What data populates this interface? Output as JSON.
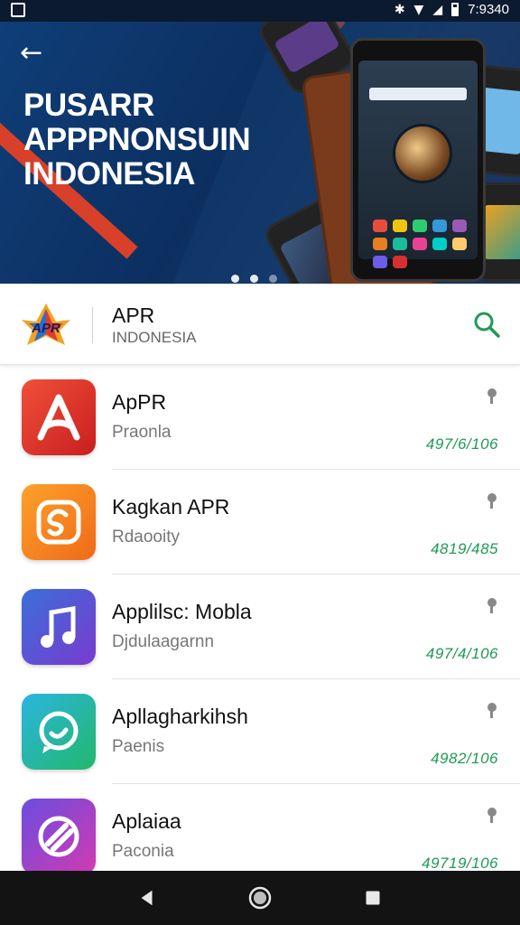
{
  "status_bar": {
    "time": "7:9340",
    "icons": [
      "image-icon",
      "bluetooth-icon",
      "wifi-icon",
      "signal-icon",
      "battery-icon"
    ]
  },
  "hero": {
    "title_lines": [
      "PUSARR",
      "APPPNONSUIN",
      "INDONESIA"
    ],
    "back_icon": "arrow-left-icon",
    "carousel_count": 3,
    "carousel_active": 0
  },
  "brand": {
    "logo_text": "APR",
    "name": "APR",
    "subtitle": "INDONESIA",
    "search_icon": "search-icon",
    "accent": "#1f9a55"
  },
  "apps": [
    {
      "name": "ApPR",
      "subtitle": "Praonla",
      "size": "497/6/106",
      "icon": "letter-a-icon",
      "color": "#e23a2e"
    },
    {
      "name": "Kagkan APR",
      "subtitle": "Rdaooity",
      "size": "4819/485",
      "icon": "swirl-icon",
      "color": "#f5871f"
    },
    {
      "name": "Applilsc: Mobla",
      "subtitle": "Djdulaagarnn",
      "size": "497/4/106",
      "icon": "music-note-icon",
      "color": "#5a43c8"
    },
    {
      "name": "Apllagharkihsh",
      "subtitle": "Paenis",
      "size": "4982/106",
      "icon": "chat-bubble-icon",
      "color": "#2fb37a"
    },
    {
      "name": "Aplaiaa",
      "subtitle": "Paconia",
      "size": "49719/106",
      "icon": "link-icon",
      "color": "#b03ac0"
    }
  ],
  "nav": [
    "back-icon",
    "home-icon",
    "recents-icon"
  ]
}
